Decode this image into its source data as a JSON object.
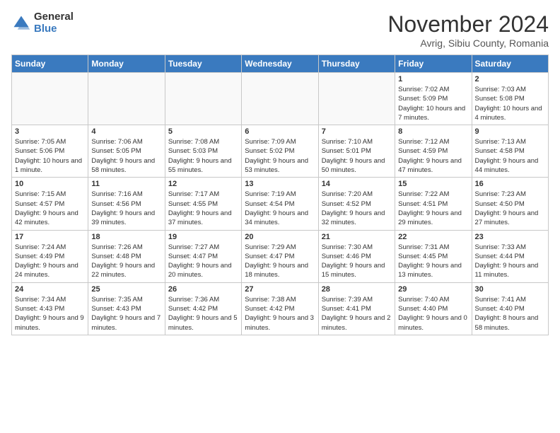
{
  "logo": {
    "general": "General",
    "blue": "Blue"
  },
  "title": "November 2024",
  "location": "Avrig, Sibiu County, Romania",
  "weekdays": [
    "Sunday",
    "Monday",
    "Tuesday",
    "Wednesday",
    "Thursday",
    "Friday",
    "Saturday"
  ],
  "weeks": [
    [
      {
        "day": "",
        "info": ""
      },
      {
        "day": "",
        "info": ""
      },
      {
        "day": "",
        "info": ""
      },
      {
        "day": "",
        "info": ""
      },
      {
        "day": "",
        "info": ""
      },
      {
        "day": "1",
        "info": "Sunrise: 7:02 AM\nSunset: 5:09 PM\nDaylight: 10 hours and 7 minutes."
      },
      {
        "day": "2",
        "info": "Sunrise: 7:03 AM\nSunset: 5:08 PM\nDaylight: 10 hours and 4 minutes."
      }
    ],
    [
      {
        "day": "3",
        "info": "Sunrise: 7:05 AM\nSunset: 5:06 PM\nDaylight: 10 hours and 1 minute."
      },
      {
        "day": "4",
        "info": "Sunrise: 7:06 AM\nSunset: 5:05 PM\nDaylight: 9 hours and 58 minutes."
      },
      {
        "day": "5",
        "info": "Sunrise: 7:08 AM\nSunset: 5:03 PM\nDaylight: 9 hours and 55 minutes."
      },
      {
        "day": "6",
        "info": "Sunrise: 7:09 AM\nSunset: 5:02 PM\nDaylight: 9 hours and 53 minutes."
      },
      {
        "day": "7",
        "info": "Sunrise: 7:10 AM\nSunset: 5:01 PM\nDaylight: 9 hours and 50 minutes."
      },
      {
        "day": "8",
        "info": "Sunrise: 7:12 AM\nSunset: 4:59 PM\nDaylight: 9 hours and 47 minutes."
      },
      {
        "day": "9",
        "info": "Sunrise: 7:13 AM\nSunset: 4:58 PM\nDaylight: 9 hours and 44 minutes."
      }
    ],
    [
      {
        "day": "10",
        "info": "Sunrise: 7:15 AM\nSunset: 4:57 PM\nDaylight: 9 hours and 42 minutes."
      },
      {
        "day": "11",
        "info": "Sunrise: 7:16 AM\nSunset: 4:56 PM\nDaylight: 9 hours and 39 minutes."
      },
      {
        "day": "12",
        "info": "Sunrise: 7:17 AM\nSunset: 4:55 PM\nDaylight: 9 hours and 37 minutes."
      },
      {
        "day": "13",
        "info": "Sunrise: 7:19 AM\nSunset: 4:54 PM\nDaylight: 9 hours and 34 minutes."
      },
      {
        "day": "14",
        "info": "Sunrise: 7:20 AM\nSunset: 4:52 PM\nDaylight: 9 hours and 32 minutes."
      },
      {
        "day": "15",
        "info": "Sunrise: 7:22 AM\nSunset: 4:51 PM\nDaylight: 9 hours and 29 minutes."
      },
      {
        "day": "16",
        "info": "Sunrise: 7:23 AM\nSunset: 4:50 PM\nDaylight: 9 hours and 27 minutes."
      }
    ],
    [
      {
        "day": "17",
        "info": "Sunrise: 7:24 AM\nSunset: 4:49 PM\nDaylight: 9 hours and 24 minutes."
      },
      {
        "day": "18",
        "info": "Sunrise: 7:26 AM\nSunset: 4:48 PM\nDaylight: 9 hours and 22 minutes."
      },
      {
        "day": "19",
        "info": "Sunrise: 7:27 AM\nSunset: 4:47 PM\nDaylight: 9 hours and 20 minutes."
      },
      {
        "day": "20",
        "info": "Sunrise: 7:29 AM\nSunset: 4:47 PM\nDaylight: 9 hours and 18 minutes."
      },
      {
        "day": "21",
        "info": "Sunrise: 7:30 AM\nSunset: 4:46 PM\nDaylight: 9 hours and 15 minutes."
      },
      {
        "day": "22",
        "info": "Sunrise: 7:31 AM\nSunset: 4:45 PM\nDaylight: 9 hours and 13 minutes."
      },
      {
        "day": "23",
        "info": "Sunrise: 7:33 AM\nSunset: 4:44 PM\nDaylight: 9 hours and 11 minutes."
      }
    ],
    [
      {
        "day": "24",
        "info": "Sunrise: 7:34 AM\nSunset: 4:43 PM\nDaylight: 9 hours and 9 minutes."
      },
      {
        "day": "25",
        "info": "Sunrise: 7:35 AM\nSunset: 4:43 PM\nDaylight: 9 hours and 7 minutes."
      },
      {
        "day": "26",
        "info": "Sunrise: 7:36 AM\nSunset: 4:42 PM\nDaylight: 9 hours and 5 minutes."
      },
      {
        "day": "27",
        "info": "Sunrise: 7:38 AM\nSunset: 4:42 PM\nDaylight: 9 hours and 3 minutes."
      },
      {
        "day": "28",
        "info": "Sunrise: 7:39 AM\nSunset: 4:41 PM\nDaylight: 9 hours and 2 minutes."
      },
      {
        "day": "29",
        "info": "Sunrise: 7:40 AM\nSunset: 4:40 PM\nDaylight: 9 hours and 0 minutes."
      },
      {
        "day": "30",
        "info": "Sunrise: 7:41 AM\nSunset: 4:40 PM\nDaylight: 8 hours and 58 minutes."
      }
    ]
  ]
}
